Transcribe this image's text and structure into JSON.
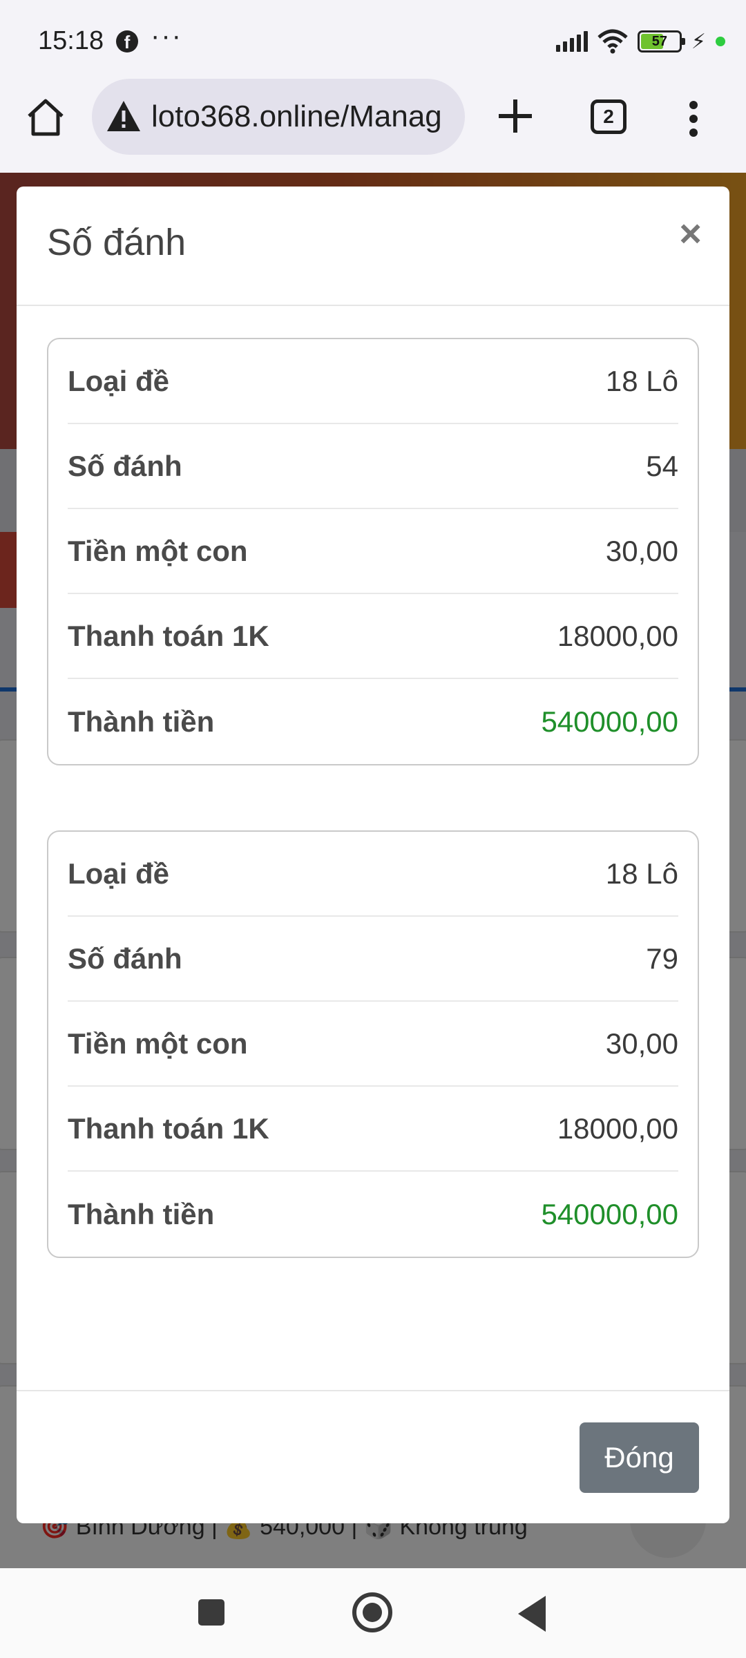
{
  "status_bar": {
    "time": "15:18",
    "notification_icons": [
      "facebook-icon",
      "more-dots-icon"
    ],
    "battery_level": "57",
    "colors": {
      "battery_fill": "#6fc22e",
      "charging_dot": "#2ecc40"
    }
  },
  "browser": {
    "url": "loto368.online/Manag",
    "tab_count": "2"
  },
  "background_page": {
    "footer_item": "🎯 Bình Dương | 💰 540,000 | 🎲 Không trúng"
  },
  "modal": {
    "title": "Số đánh",
    "close_symbol": "×",
    "entries": [
      {
        "rows": [
          {
            "label": "Loại đề",
            "value": "18 Lô"
          },
          {
            "label": "Số đánh",
            "value": "54"
          },
          {
            "label": "Tiền một con",
            "value": "30,00"
          },
          {
            "label": "Thanh toán 1K",
            "value": "18000,00"
          },
          {
            "label": "Thành tiền",
            "value": "540000,00"
          }
        ]
      },
      {
        "rows": [
          {
            "label": "Loại đề",
            "value": "18 Lô"
          },
          {
            "label": "Số đánh",
            "value": "79"
          },
          {
            "label": "Tiền một con",
            "value": "30,00"
          },
          {
            "label": "Thanh toán 1K",
            "value": "18000,00"
          },
          {
            "label": "Thành tiền",
            "value": "540000,00"
          }
        ]
      }
    ],
    "footer": {
      "close_button_label": "Đóng"
    },
    "colors": {
      "total_value": "#1f8f2a",
      "close_button": "#6c757d"
    }
  }
}
